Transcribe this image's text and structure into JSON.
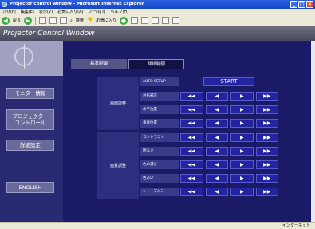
{
  "window": {
    "title": "Projector control window - Microsoft Internet Explorer",
    "buttons": [
      "_",
      "□",
      "×"
    ]
  },
  "menubar": [
    "ﾌｧｲﾙ(F)",
    "編集(E)",
    "表示(V)",
    "お気に入り(A)",
    "ツール(T)",
    "ヘルプ(H)"
  ],
  "toolbar": {
    "back_label": "戻る",
    "search_label": "検索",
    "favorites_label": "お気に入り"
  },
  "app": {
    "title": "Projector Control Window",
    "sidebar": {
      "monitor": "モニター情報",
      "projector_control": "プロジェクター\nコントロール",
      "detail_settings": "詳細設定",
      "english": "ENGLISH"
    },
    "tabs": {
      "basic": "基本制御",
      "detail": "詳細制御"
    },
    "groups": {
      "screen_adjust": "画面調整",
      "picture_adjust": "画質調整"
    },
    "auto_setup": {
      "label": "AUTO SETUP",
      "button": "START"
    },
    "rows": [
      {
        "label": "台形補正"
      },
      {
        "label": "水平位置"
      },
      {
        "label": "垂直位置"
      },
      {
        "label": "コントラスト"
      },
      {
        "label": "明るさ"
      },
      {
        "label": "色の濃さ"
      },
      {
        "label": "色あい"
      },
      {
        "label": "シャープネス"
      }
    ],
    "arrows": [
      "◀◀",
      "◀",
      "▶",
      "▶▶"
    ]
  },
  "status": {
    "zone": "インターネット"
  }
}
